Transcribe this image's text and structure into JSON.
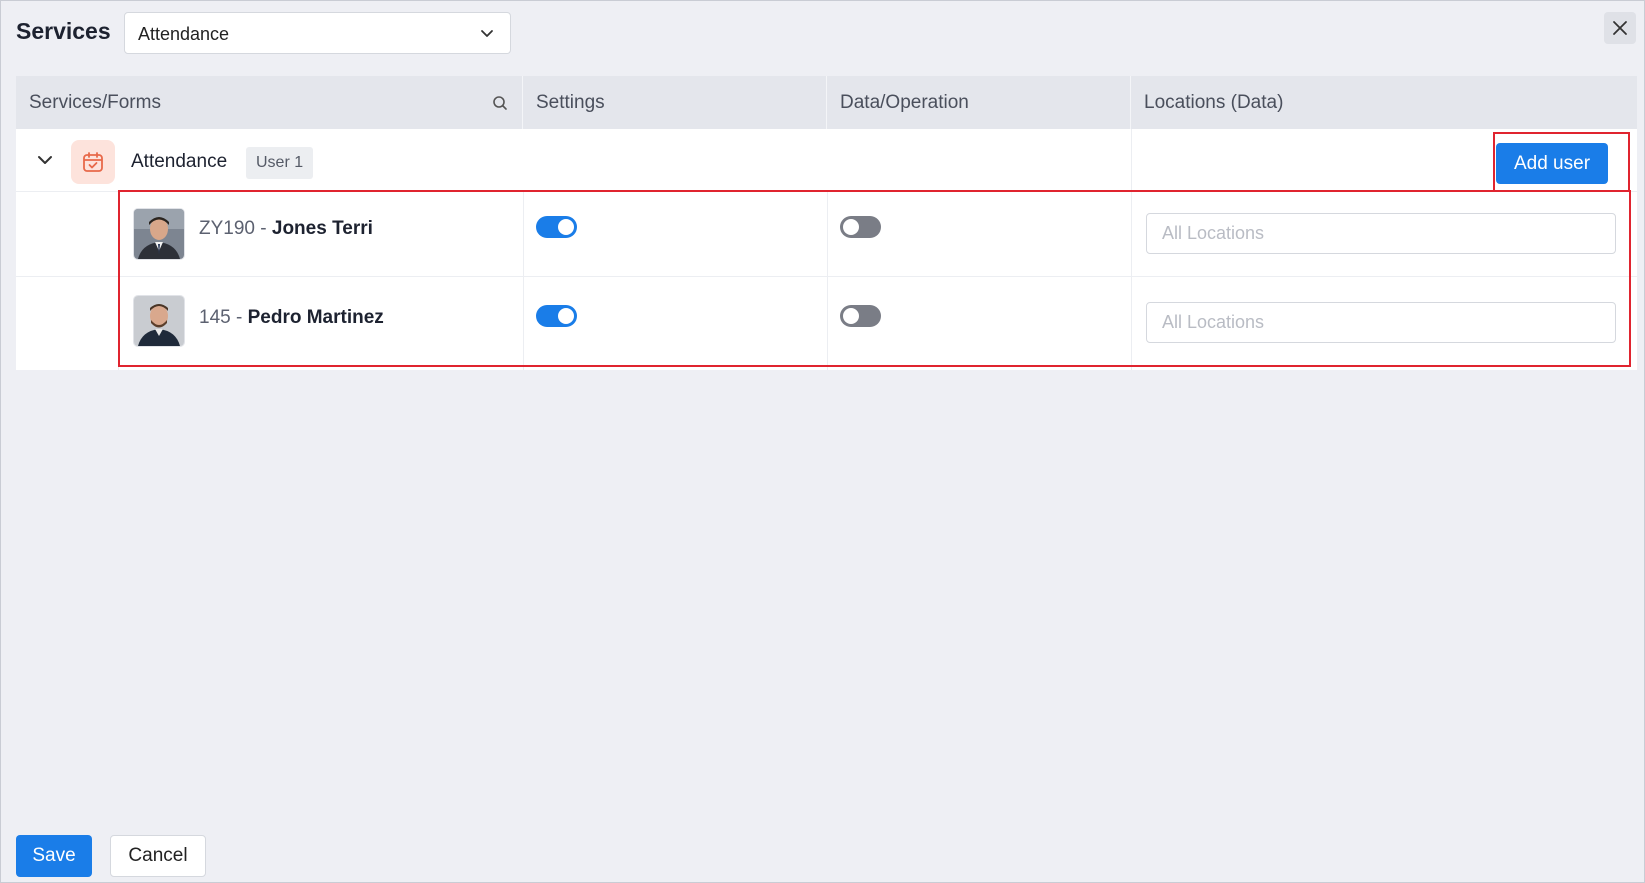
{
  "header": {
    "title": "Services",
    "service_select": {
      "value": "Attendance"
    }
  },
  "table": {
    "columns": [
      "Services/Forms",
      "Settings",
      "Data/Operation",
      "Locations (Data)"
    ],
    "group": {
      "name": "Attendance",
      "badge": "User 1",
      "add_user_label": "Add user"
    },
    "users": [
      {
        "id": "ZY190",
        "separator": " - ",
        "name": "Jones Terri",
        "settings_on": true,
        "data_on": false,
        "locations_placeholder": "All Locations"
      },
      {
        "id": "145",
        "separator": " - ",
        "name": "Pedro Martinez",
        "settings_on": true,
        "data_on": false,
        "locations_placeholder": "All Locations"
      }
    ]
  },
  "footer": {
    "save_label": "Save",
    "cancel_label": "Cancel"
  },
  "colors": {
    "primary": "#1a7de8",
    "highlight": "#e0242f",
    "toggle_off": "#7a7d86",
    "form_icon": "#e8694a"
  },
  "icons": [
    "chevron-down-icon",
    "close-icon",
    "search-icon",
    "calendar-check-icon"
  ]
}
